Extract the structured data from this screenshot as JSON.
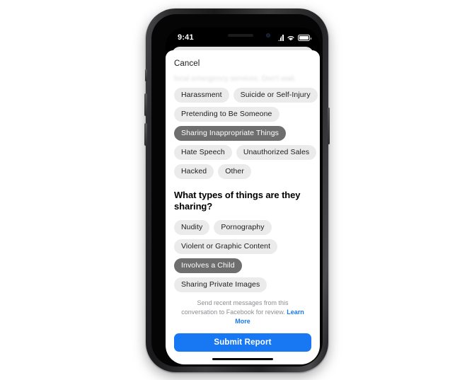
{
  "status_bar": {
    "time": "9:41",
    "icons": [
      "cellular-signal-icon",
      "wifi-icon",
      "battery-icon"
    ]
  },
  "sheet": {
    "cancel_label": "Cancel",
    "faded_text": "local emergency services. Don't wait.",
    "reason_chips": [
      [
        {
          "label": "Harassment",
          "selected": false
        },
        {
          "label": "Suicide or Self-Injury",
          "selected": false
        }
      ],
      [
        {
          "label": "Pretending to Be Someone",
          "selected": false
        }
      ],
      [
        {
          "label": "Sharing Inappropriate Things",
          "selected": true
        }
      ],
      [
        {
          "label": "Hate Speech",
          "selected": false
        },
        {
          "label": "Unauthorized Sales",
          "selected": false
        }
      ],
      [
        {
          "label": "Hacked",
          "selected": false
        },
        {
          "label": "Other",
          "selected": false
        }
      ]
    ],
    "question_heading": "What types of things are they sharing?",
    "type_chips": [
      [
        {
          "label": "Nudity",
          "selected": false
        },
        {
          "label": "Pornography",
          "selected": false
        }
      ],
      [
        {
          "label": "Violent or Graphic Content",
          "selected": false
        }
      ],
      [
        {
          "label": "Involves a Child",
          "selected": true
        }
      ],
      [
        {
          "label": "Sharing Private Images",
          "selected": false
        }
      ]
    ],
    "footer_note_text": "Send recent messages from this conversation to Facebook for review. ",
    "learn_more_label": "Learn More",
    "submit_label": "Submit Report"
  },
  "colors": {
    "accent_blue": "#1877f2",
    "chip_unselected_bg": "#ebebeb",
    "chip_selected_bg": "#6e6e6e",
    "muted_text": "#8e8e93"
  }
}
